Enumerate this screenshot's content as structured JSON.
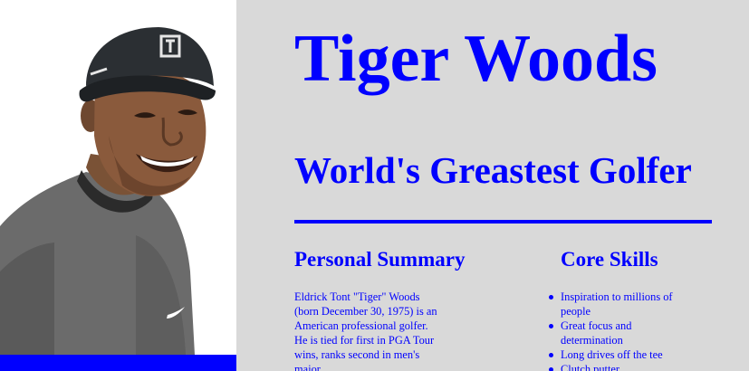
{
  "profile": {
    "name": "Tiger Woods",
    "tagline": "World's Greastest Golfer",
    "photo_alt": "portrait"
  },
  "summary": {
    "heading": "Personal Summary",
    "text": "Eldrick Tont \"Tiger\" Woods (born December 30, 1975) is an American professional golfer. He is tied for first in PGA Tour wins, ranks second in men's major"
  },
  "skills": {
    "heading": "Core Skills",
    "items": [
      "Inspiration to millions of people",
      "Great focus and determination",
      "Long drives off the tee",
      "Clutch putter"
    ]
  },
  "colors": {
    "accent": "#0000ff",
    "page_background": "#d9d9d9",
    "photo_background": "#ffffff"
  }
}
